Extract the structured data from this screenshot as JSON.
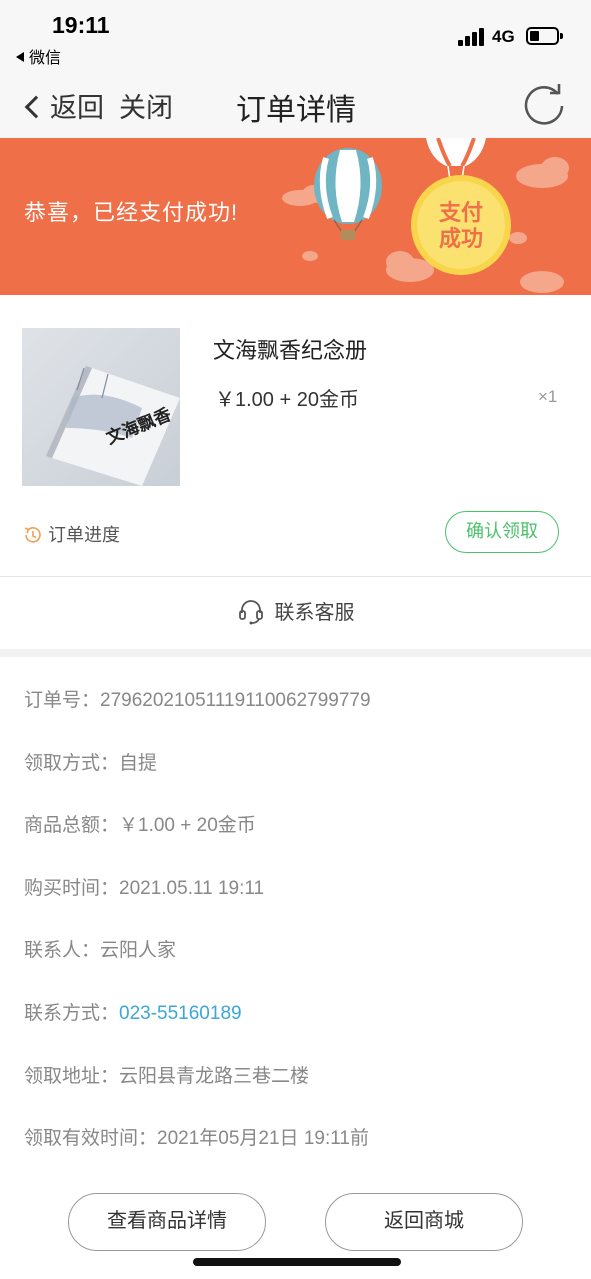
{
  "status_bar": {
    "time": "19:11",
    "back_app": "微信",
    "network": "4G",
    "battery_level": 0.25
  },
  "nav": {
    "back_label": "返回",
    "close_label": "关闭",
    "title": "订单详情"
  },
  "banner": {
    "message": "恭喜，已经支付成功!",
    "seal_line1": "支付",
    "seal_line2": "成功",
    "bg_color": "#ef6f49"
  },
  "product": {
    "name": "文海飘香纪念册",
    "price": "￥1.00 + 20金币",
    "quantity": "×1",
    "image_text": "文海飘香",
    "progress_label": "订单进度",
    "confirm_label": "确认领取"
  },
  "service": {
    "label": "联系客服"
  },
  "details": {
    "order_no_label": "订单号：",
    "order_no": "27962021051119110062799779",
    "pickup_method_label": "领取方式：",
    "pickup_method": "自提",
    "total_label": "商品总额：",
    "total": "￥1.00 + 20金币",
    "purchase_time_label": "购买时间：",
    "purchase_time": "2021.05.11 19:11",
    "contact_label": "联系人：",
    "contact": "云阳人家",
    "phone_label": "联系方式：",
    "phone": "023-55160189",
    "address_label": "领取地址：",
    "address": "云阳县青龙路三巷二楼",
    "valid_label": "领取有效时间：",
    "valid": "2021年05月21日 19:11前"
  },
  "buttons": {
    "view_detail": "查看商品详情",
    "back_mall": "返回商城"
  },
  "colors": {
    "accent_green": "#4cc06a",
    "link_blue": "#3aa7d8",
    "banner_orange": "#ef6f49"
  }
}
